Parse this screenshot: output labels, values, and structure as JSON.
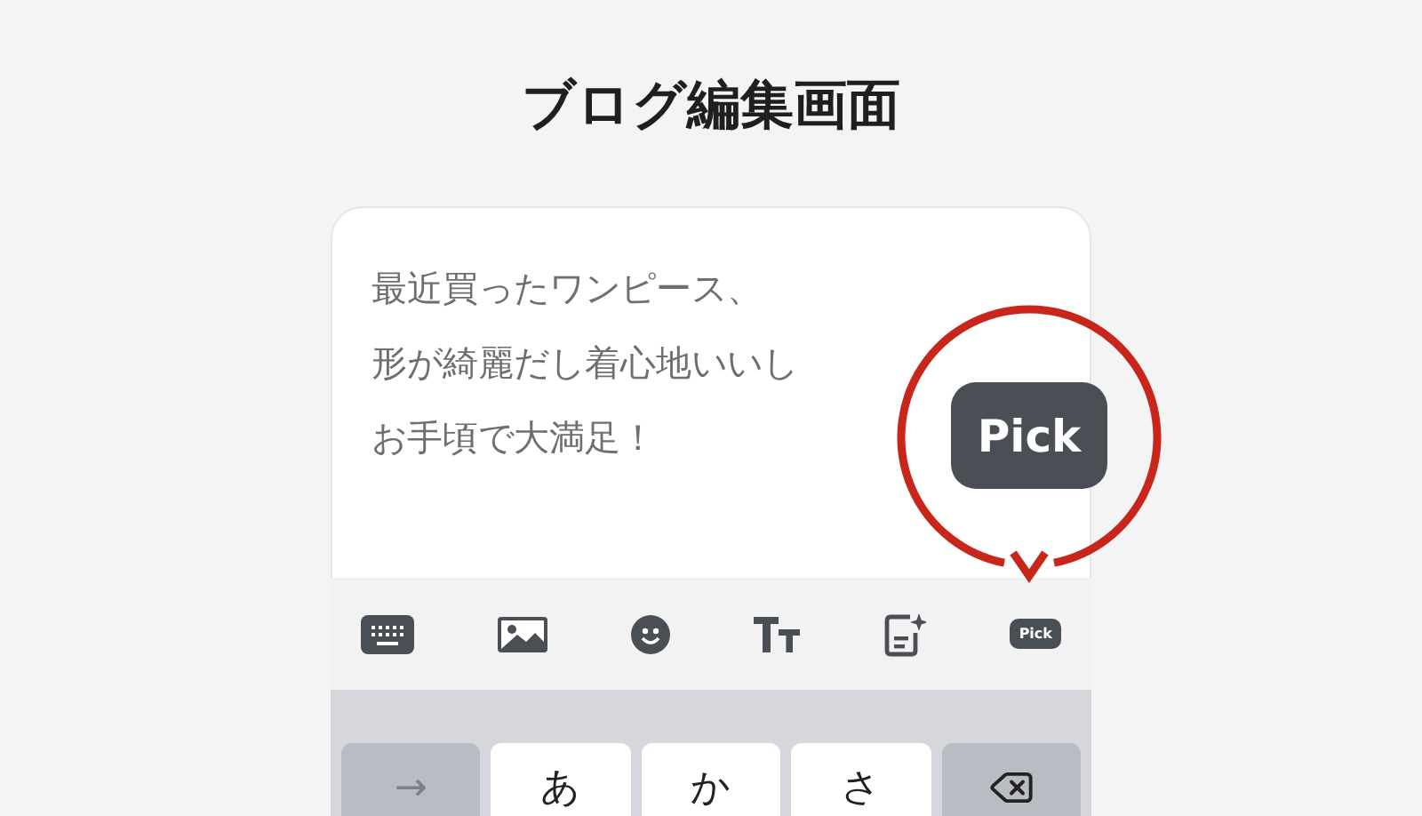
{
  "title": "ブログ編集画面",
  "editor": {
    "lines": [
      "最近買ったワンピース、",
      "形が綺麗だし着心地いいし",
      "お手頃で大満足！"
    ]
  },
  "callout": {
    "label": "Pick"
  },
  "toolbar": [
    {
      "kind": "keyboard"
    },
    {
      "kind": "image"
    },
    {
      "kind": "emoji"
    },
    {
      "kind": "text-size"
    },
    {
      "kind": "ai-document"
    },
    {
      "kind": "pick",
      "label": "Pick"
    }
  ],
  "keyboard": {
    "keys": [
      {
        "kind": "arrow",
        "label": "→"
      },
      {
        "kind": "char",
        "label": "あ"
      },
      {
        "kind": "char",
        "label": "か"
      },
      {
        "kind": "char",
        "label": "さ"
      },
      {
        "kind": "backspace"
      }
    ]
  }
}
